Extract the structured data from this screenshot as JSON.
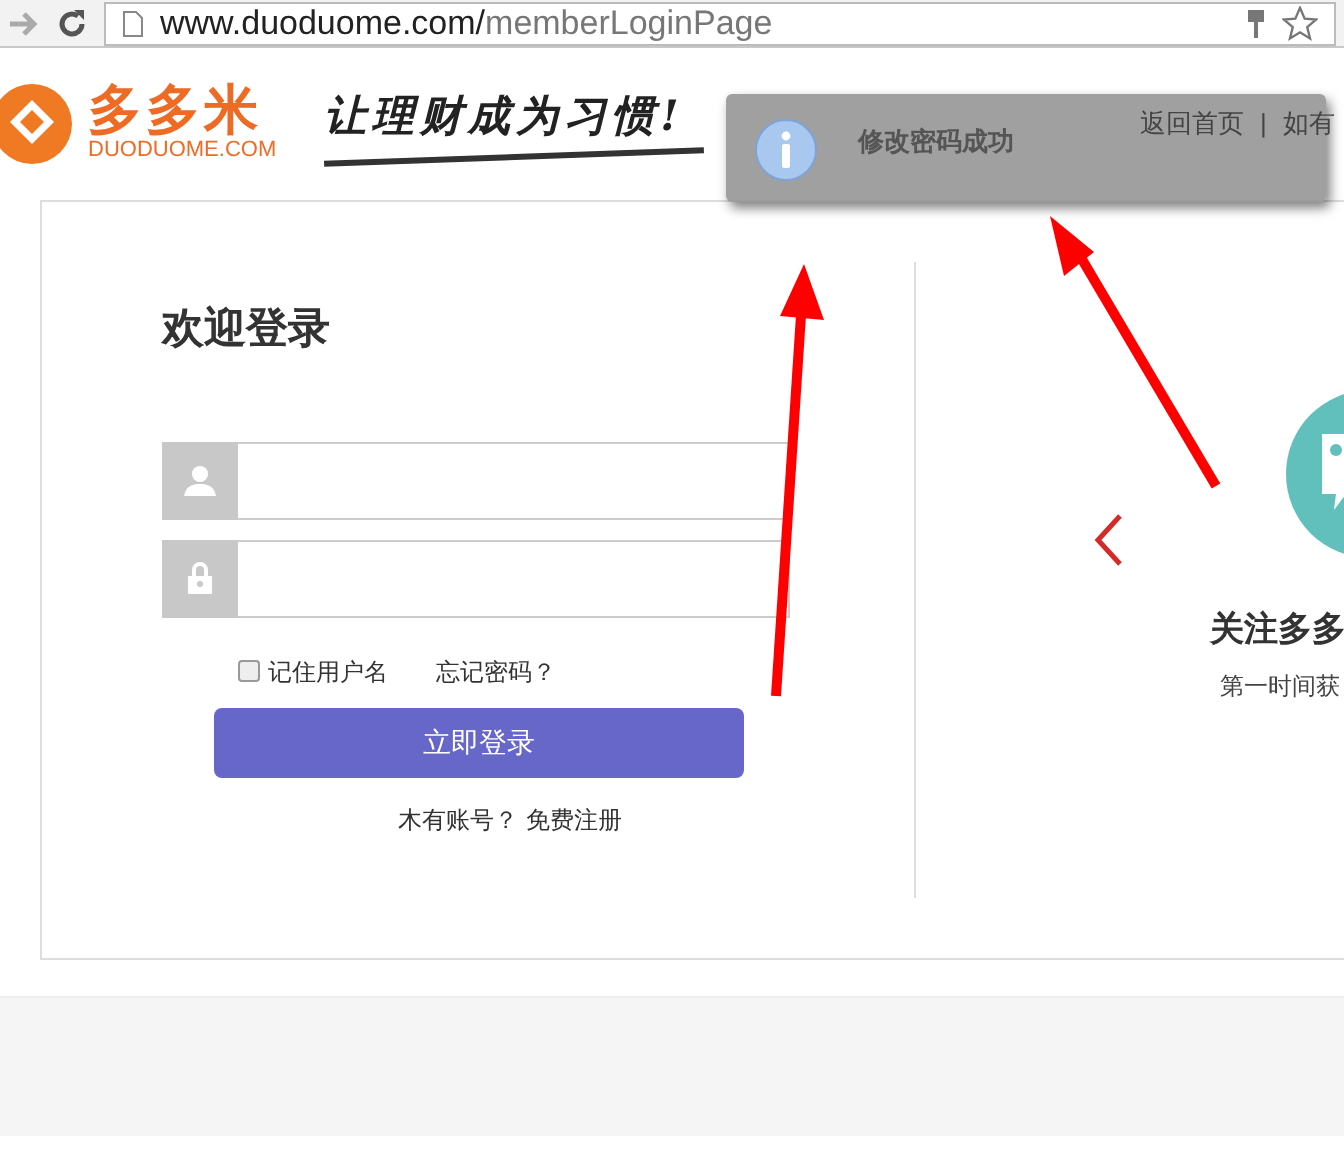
{
  "browser": {
    "url_host": "www.duoduome.com/",
    "url_path": "memberLoginPage"
  },
  "header": {
    "logo_name": "多多米",
    "logo_domain": "DUODUOME.COM",
    "slogan": "让理财成为习惯!",
    "nav": [
      "返回首页",
      "|",
      "如有"
    ]
  },
  "toast": {
    "message": "修改密码成功"
  },
  "login": {
    "title": "欢迎登录",
    "fields": [
      {
        "kind": "user"
      },
      {
        "kind": "lock"
      }
    ],
    "remember": {
      "label": "记住用户名",
      "checked": false
    },
    "forgot": "忘记密码？",
    "submit": "立即登录",
    "no_account": "木有账号？",
    "register": "免费注册"
  },
  "promo": {
    "title": "关注多多",
    "subtitle": "第一时间获"
  }
}
